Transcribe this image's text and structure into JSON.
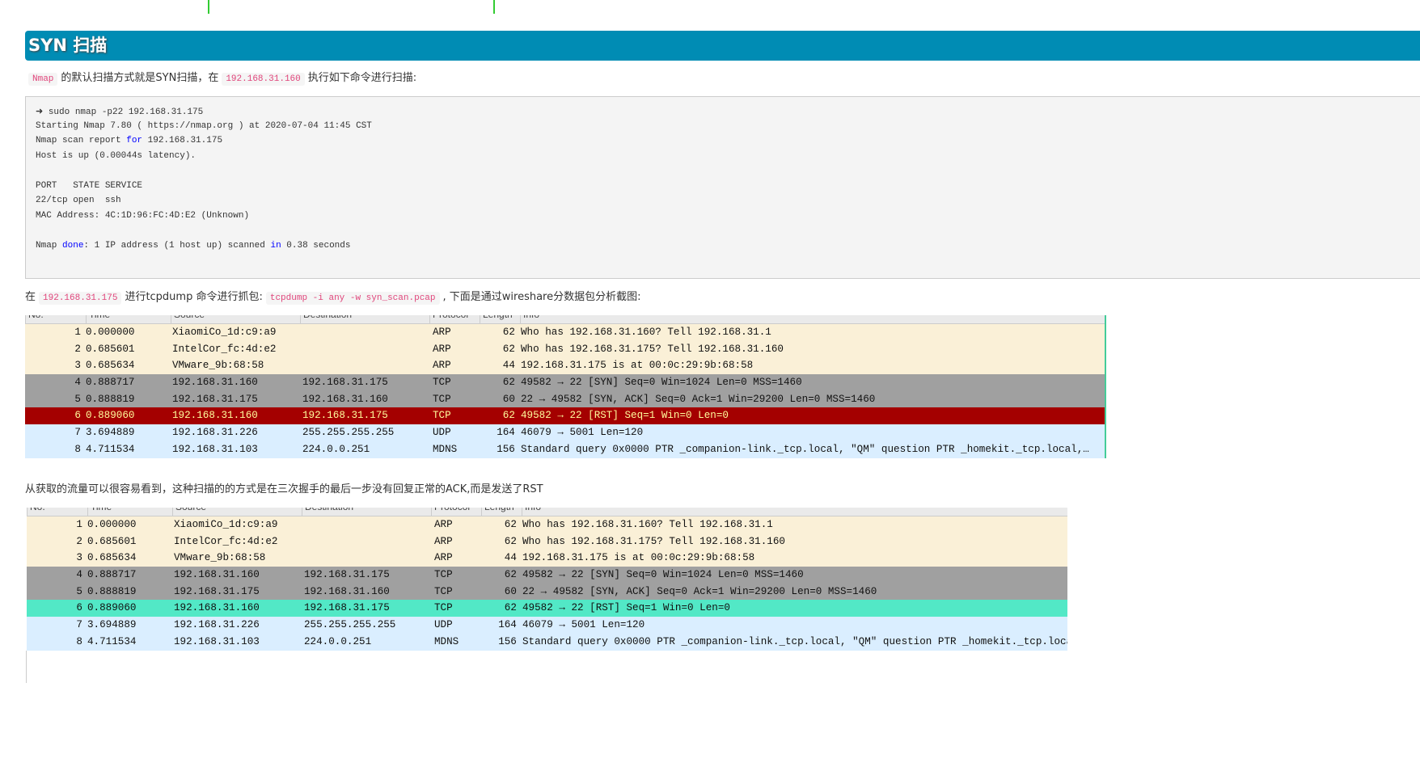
{
  "heading": "SYN 扫描",
  "para1": {
    "code1": "Nmap",
    "text1": "的默认扫描方式就是SYN扫描，在",
    "code2": "192.168.31.160",
    "text2": "执行如下命令进行扫描:"
  },
  "code_lines": [
    "➜ sudo nmap -p22 192.168.31.175",
    "Starting Nmap 7.80 ( https://nmap.org ) at 2020-07-04 11:45 CST",
    "Nmap scan report |for| 192.168.31.175",
    "Host is up (0.00044s latency).",
    "",
    "PORT   STATE SERVICE",
    "22/tcp open  ssh",
    "MAC Address: 4C:1D:96:FC:4D:E2 (Unknown)",
    "",
    "Nmap |done|: 1 IP address (1 host up) scanned |in| 0.38 seconds"
  ],
  "para2": {
    "text1": "在",
    "code1": "192.168.31.175",
    "text2": "进行tcpdump 命令进行抓包:",
    "code2": "tcpdump -i any -w syn_scan.pcap",
    "text3": ", 下面是通过wireshare分数据包分析截图:"
  },
  "para3": "从获取的流量可以很容易看到，这种扫描的的方式是在三次握手的最后一步没有回复正常的ACK,而是发送了RST",
  "columns": [
    "No.",
    "Time",
    "Source",
    "Destination",
    "Protocol",
    "Length",
    "Info"
  ],
  "packets": [
    {
      "no": "1",
      "time": "0.000000",
      "src": "XiaomiCo_1d:c9:a9",
      "dst": "",
      "proto": "ARP",
      "len": "62",
      "info": "Who has 192.168.31.160? Tell 192.168.31.1"
    },
    {
      "no": "2",
      "time": "0.685601",
      "src": "IntelCor_fc:4d:e2",
      "dst": "",
      "proto": "ARP",
      "len": "62",
      "info": "Who has 192.168.31.175? Tell 192.168.31.160"
    },
    {
      "no": "3",
      "time": "0.685634",
      "src": "VMware_9b:68:58",
      "dst": "",
      "proto": "ARP",
      "len": "44",
      "info": "192.168.31.175 is at 00:0c:29:9b:68:58"
    },
    {
      "no": "4",
      "time": "0.888717",
      "src": "192.168.31.160",
      "dst": "192.168.31.175",
      "proto": "TCP",
      "len": "62",
      "info": "49582 → 22 [SYN] Seq=0 Win=1024 Len=0 MSS=1460"
    },
    {
      "no": "5",
      "time": "0.888819",
      "src": "192.168.31.175",
      "dst": "192.168.31.160",
      "proto": "TCP",
      "len": "60",
      "info": "22 → 49582 [SYN, ACK] Seq=0 Ack=1 Win=29200 Len=0 MSS=1460"
    },
    {
      "no": "6",
      "time": "0.889060",
      "src": "192.168.31.160",
      "dst": "192.168.31.175",
      "proto": "TCP",
      "len": "62",
      "info": "49582 → 22 [RST] Seq=1 Win=0 Len=0"
    },
    {
      "no": "7",
      "time": "3.694889",
      "src": "192.168.31.226",
      "dst": "255.255.255.255",
      "proto": "UDP",
      "len": "164",
      "info": "46079 → 5001 Len=120"
    },
    {
      "no": "8",
      "time": "4.711534",
      "src": "192.168.31.103",
      "dst": "224.0.0.251",
      "proto": "MDNS",
      "len": "156",
      "info": "Standard query 0x0000 PTR _companion-link._tcp.local, \"QM\" question PTR _homekit._tcp.local,…"
    }
  ],
  "colors": {
    "heading": "#008cb4",
    "rst_row": "#a40000",
    "selected_row": "#52e8c6"
  }
}
